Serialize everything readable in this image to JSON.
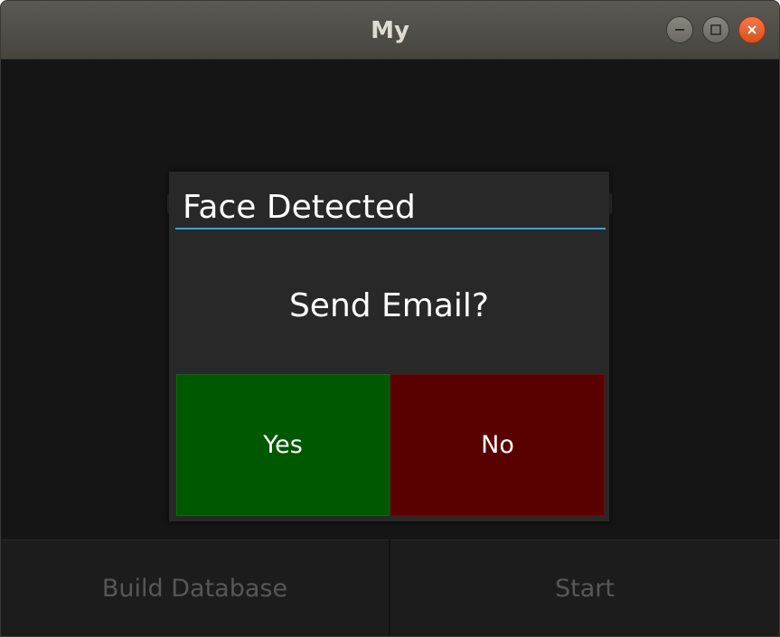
{
  "window": {
    "title": "My"
  },
  "dialog": {
    "title": "Face Detected",
    "message": "Send Email?",
    "yes_label": "Yes",
    "no_label": "No",
    "accent_color": "#33a6d5",
    "yes_color": "#005900",
    "no_color": "#590000"
  },
  "bottom_bar": {
    "build_label": "Build Database",
    "start_label": "Start"
  },
  "icons": {
    "minimize": "minimize-icon",
    "maximize": "maximize-icon",
    "close": "close-icon"
  }
}
